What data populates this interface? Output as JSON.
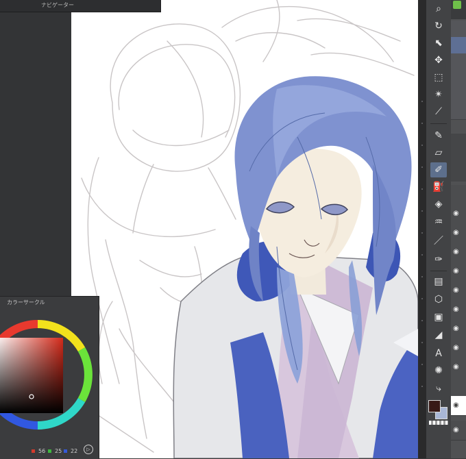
{
  "navigator": {
    "title": "ナビゲーター"
  },
  "color_panel": {
    "title": "カラーサークル",
    "r": "56",
    "g": "25",
    "b": "22",
    "current_color": "#381916"
  },
  "toolbar": {
    "tools": [
      "zoom-icon",
      "rotate-icon",
      "object-icon",
      "move-icon",
      "selection-icon",
      "auto-select-icon",
      "eyedropper-icon",
      "pen-icon",
      "eraser-icon",
      "brush-icon",
      "fill-icon",
      "blend-icon",
      "line-icon",
      "correction-icon",
      "gradient-icon",
      "figure-icon",
      "frame-icon",
      "text-icon",
      "balloon-icon",
      "ruler-icon"
    ]
  },
  "colors": {
    "canvas": "#ffffff",
    "active_tool": "#5d6f8c",
    "main_color": "#381916",
    "sub_color": "#a9b7d6"
  }
}
